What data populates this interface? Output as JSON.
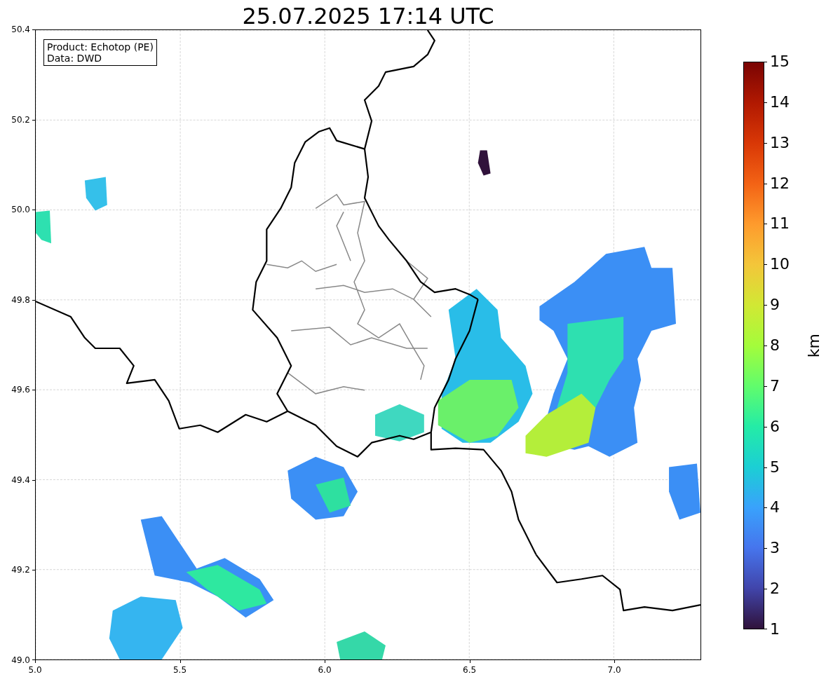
{
  "plot": {
    "chart_data": {
      "type": "scatter",
      "title": "25.07.2025 17:14 UTC",
      "xlim": [
        5.0,
        7.3
      ],
      "ylim": [
        49.0,
        50.4
      ],
      "xticks": [
        {
          "value": 5.0,
          "label": "5.0"
        },
        {
          "value": 5.5,
          "label": "5.5"
        },
        {
          "value": 6.0,
          "label": "6.0"
        },
        {
          "value": 6.5,
          "label": "6.5"
        },
        {
          "value": 7.0,
          "label": "7.0"
        }
      ],
      "yticks": [
        {
          "value": 49.0,
          "label": "49.0"
        },
        {
          "value": 49.2,
          "label": "49.2"
        },
        {
          "value": 49.4,
          "label": "49.4"
        },
        {
          "value": 49.6,
          "label": "49.6"
        },
        {
          "value": 49.8,
          "label": "49.8"
        },
        {
          "value": 50.0,
          "label": "50.0"
        },
        {
          "value": 50.2,
          "label": "50.2"
        },
        {
          "value": 50.4,
          "label": "50.4"
        }
      ],
      "grid": true
    },
    "info_box": [
      "Product: Echotop (PE)",
      "Data: DWD"
    ]
  },
  "colorbar": {
    "label": "km",
    "ticks": [
      "15",
      "14",
      "13",
      "12",
      "11",
      "10",
      "9",
      "8",
      "7",
      "6",
      "5",
      "4",
      "3",
      "2",
      "1"
    ]
  }
}
